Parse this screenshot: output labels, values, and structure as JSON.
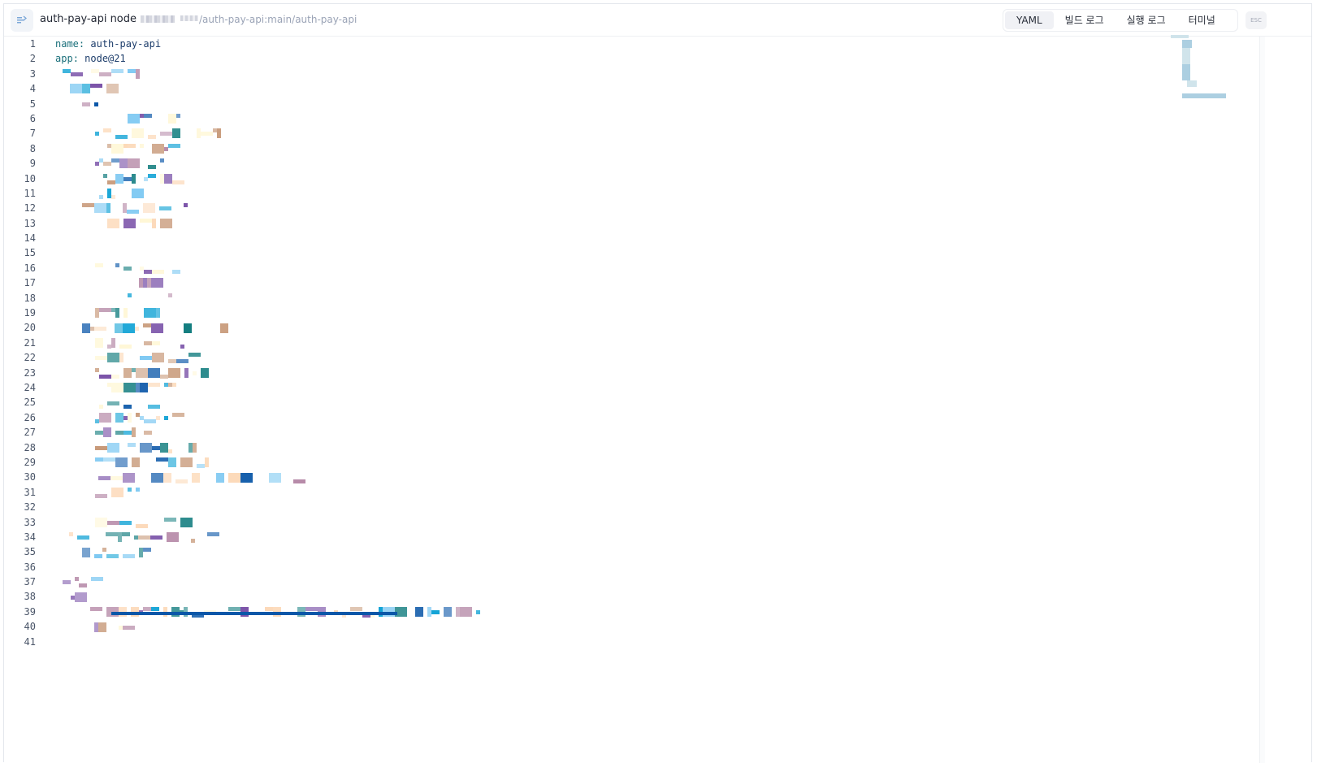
{
  "header": {
    "title": "auth-pay-api node",
    "path": "/auth-pay-api:main/auth-pay-api",
    "esc": "ESC",
    "tabs": [
      {
        "label": "YAML",
        "active": true
      },
      {
        "label": "빌드 로그",
        "active": false
      },
      {
        "label": "실행 로그",
        "active": false
      },
      {
        "label": "터미널",
        "active": false
      }
    ]
  },
  "editor": {
    "line_numbers": [
      "1",
      "2",
      "3",
      "4",
      "5",
      "6",
      "7",
      "8",
      "9",
      "10",
      "11",
      "12",
      "13",
      "14",
      "15",
      "16",
      "17",
      "18",
      "19",
      "20",
      "21",
      "22",
      "23",
      "24",
      "25",
      "26",
      "27",
      "28",
      "29",
      "30",
      "31",
      "32",
      "33",
      "34",
      "35",
      "36",
      "37",
      "38",
      "39",
      "40",
      "41"
    ],
    "lines": [
      {
        "key": "name",
        "sep": ": ",
        "value": "auth-pay-api"
      },
      {
        "key": "app",
        "sep": ": ",
        "value": "node@21"
      }
    ]
  },
  "colors": {
    "accent": "#0b57a8",
    "teal": "#0f7b7d",
    "sky": "#7cc8f2",
    "cyan": "#0aa0d4",
    "tan": "#c89a7a",
    "peach": "#fcd9b8",
    "mauve": "#b68aa8",
    "purple": "#7a52a8",
    "cream": "#fff7d6"
  }
}
